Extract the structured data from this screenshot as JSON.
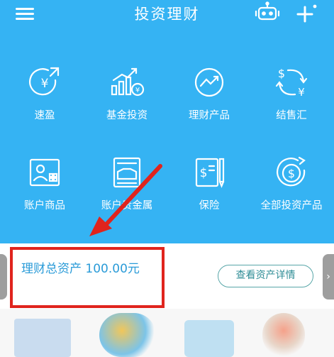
{
  "header": {
    "title": "投资理财",
    "menu_icon": "hamburger-menu-icon",
    "robot_icon": "robot-icon",
    "add_icon": "plus-icon"
  },
  "grid": {
    "items": [
      {
        "label": "速盈",
        "icon": "yuan-up-arrow-icon"
      },
      {
        "label": "基金投资",
        "icon": "bar-chart-coin-icon"
      },
      {
        "label": "理财产品",
        "icon": "trend-line-icon"
      },
      {
        "label": "结售汇",
        "icon": "currency-exchange-icon"
      },
      {
        "label": "账户商品",
        "icon": "id-card-icon"
      },
      {
        "label": "账户贵金属",
        "icon": "gold-bar-icon"
      },
      {
        "label": "保险",
        "icon": "insurance-document-icon"
      },
      {
        "label": "全部投资产品",
        "icon": "dollar-coin-icon"
      }
    ]
  },
  "asset": {
    "total_label": "理财总资产 100.00元",
    "view_button": "查看资产详情"
  },
  "colors": {
    "header_bg": "#35b3f3",
    "highlight": "#e0241d",
    "asset_text": "#2a9bd8",
    "button_border": "#58a6a8"
  }
}
